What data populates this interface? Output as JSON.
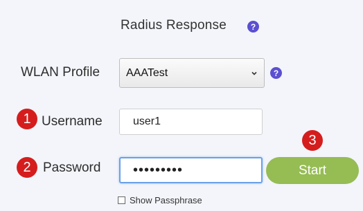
{
  "header": {
    "title": "Radius Response",
    "help_icon": "question-circle-icon"
  },
  "wlan_profile": {
    "label": "WLAN Profile",
    "selected": "AAATest",
    "help_icon": "question-circle-icon"
  },
  "username": {
    "label": "Username",
    "value": "user1",
    "step": "1"
  },
  "password": {
    "label": "Password",
    "masked_value": "•••••••••",
    "step": "2"
  },
  "start_button": {
    "label": "Start",
    "step": "3"
  },
  "show_passphrase": {
    "label": "Show Passphrase",
    "checked": false
  },
  "colors": {
    "accent_help": "#5b4fd1",
    "step_badge": "#d51d1d",
    "start_button": "#96bc54",
    "focus_border": "#6aa0e8"
  }
}
